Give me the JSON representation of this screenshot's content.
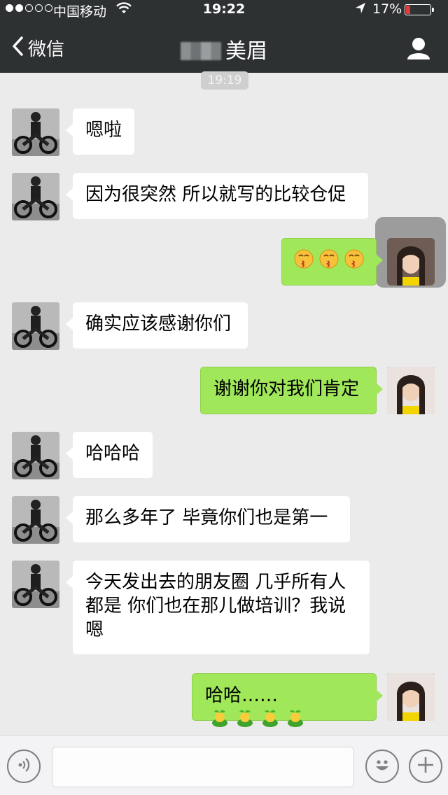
{
  "status_bar": {
    "carrier": "中国移动",
    "time": "19:22",
    "battery_percent": "17%",
    "battery_level": 0.17,
    "signal_bars_filled": 2,
    "signal_bars_total": 5
  },
  "nav": {
    "back_label": "微信",
    "title": "美眉"
  },
  "timestamp": "19:19",
  "messages": [
    {
      "side": "left",
      "text": "嗯啦"
    },
    {
      "side": "left",
      "text": "因为很突然 所以就写的比较仓促"
    },
    {
      "side": "right",
      "emojis": [
        "kiss-face-icon",
        "kiss-face-icon",
        "kiss-face-icon"
      ]
    },
    {
      "side": "left",
      "text": "确实应该感谢你们"
    },
    {
      "side": "right",
      "text": "谢谢你对我们肯定"
    },
    {
      "side": "left",
      "text": "哈哈哈"
    },
    {
      "side": "left",
      "text": "那么多年了 毕竟你们也是第一"
    },
    {
      "side": "left",
      "lines": [
        "今天发出去的朋友圈 几乎所有人",
        "都是 你们也在那儿做培训？我说",
        "嗯"
      ]
    },
    {
      "side": "right",
      "text": "哈哈……",
      "emojis": [
        "sprout-icon",
        "sprout-icon",
        "sprout-icon",
        "sprout-icon"
      ]
    }
  ],
  "colors": {
    "header_bg": "#2e3132",
    "chat_bg": "#ebebeb",
    "outgoing_bubble": "#a0e75a",
    "incoming_bubble": "#ffffff"
  }
}
